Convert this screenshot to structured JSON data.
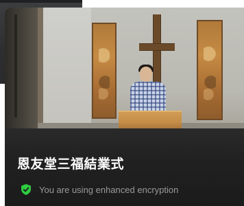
{
  "call": {
    "title": "恩友堂三福結業式",
    "encryption_text": "You are using enhanced encryption",
    "encryption_icon": "shield-check-icon",
    "accent_color": "#2ecc40"
  }
}
